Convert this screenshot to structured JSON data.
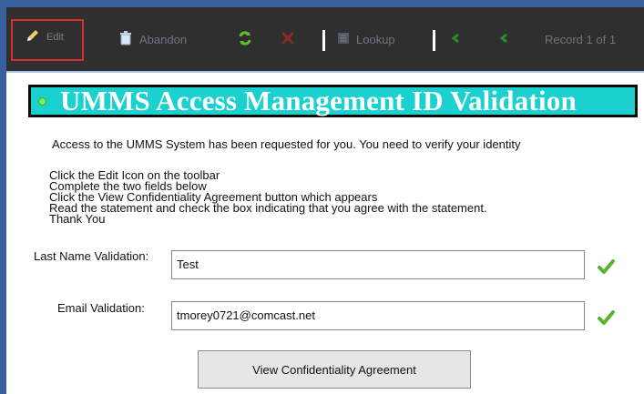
{
  "toolbar": {
    "edit": "Edit",
    "abandon": "Abandon",
    "lookup": "Lookup",
    "record": "Record 1 of 1",
    "icons": {
      "edit": "pencil-icon",
      "abandon": "trash-icon",
      "refresh": "refresh-icon",
      "delete": "delete-icon",
      "lookup": "lookup-icon",
      "prev": "previous-record-icon",
      "next": "next-record-icon"
    }
  },
  "banner": {
    "title": "UMMS Access Management ID Validation"
  },
  "content": {
    "intro": "Access to the UMMS System has been requested for you. You need to verify your identity",
    "instructions": [
      "Click the Edit Icon on the toolbar",
      "Complete the two fields below",
      "Click the View Confidentiality Agreement button which appears",
      "Read the statement and check the box indicating that you agree with the statement.",
      "Thank You"
    ]
  },
  "fields": {
    "last_name": {
      "label": "Last Name Validation:",
      "value": "Test"
    },
    "email": {
      "label": "Email Validation:",
      "value": "tmorey0721@comcast.net"
    }
  },
  "actions": {
    "view_agreement": "View Confidentiality Agreement"
  },
  "colors": {
    "toolbar": "#2f2f2f",
    "banner": "#1bd1cf",
    "highlight": "#d92d2d",
    "valid": "#55b52f"
  }
}
